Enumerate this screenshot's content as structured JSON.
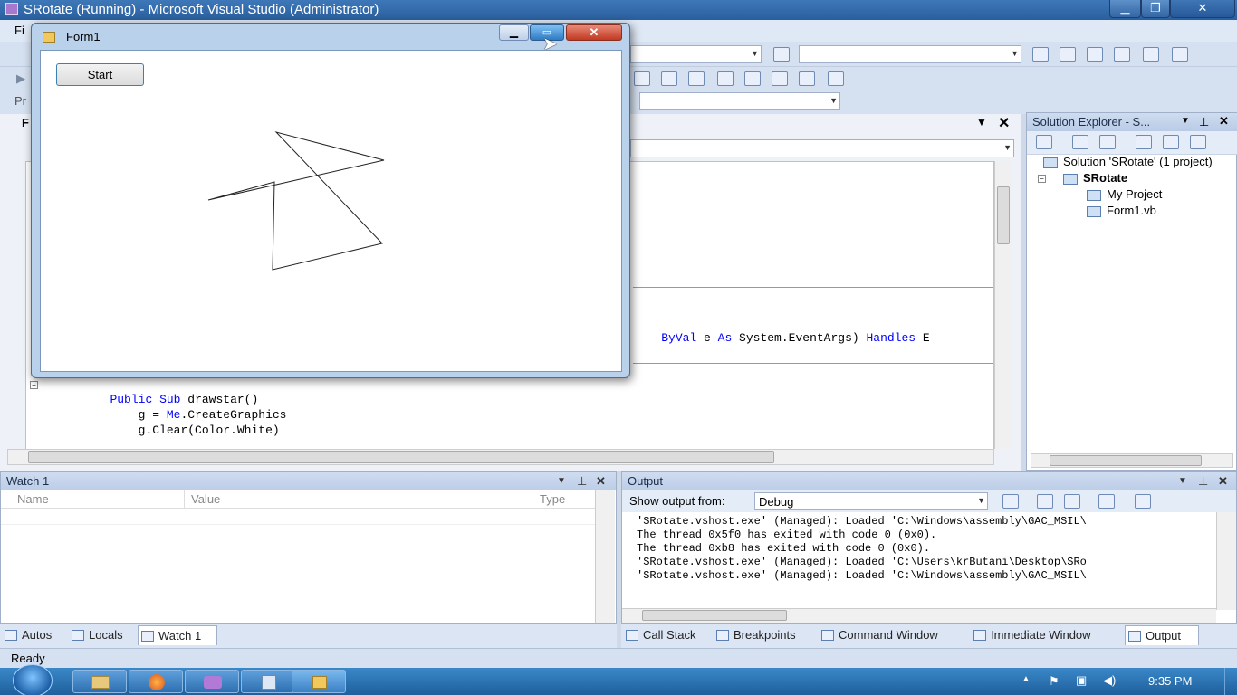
{
  "vs": {
    "title": "SRotate (Running) - Microsoft Visual Studio (Administrator)",
    "menu_first": "Fi",
    "toolbar_fragments": {
      "pr": "Pr"
    },
    "editor_tab": "F"
  },
  "editor": {
    "lines": [
      {
        "indent": "    ",
        "kw1": "Public",
        "mid": " ",
        "kw2": "Sub",
        "rest": " drawstar()"
      },
      {
        "indent": "        ",
        "pre": "g = ",
        "kw": "Me",
        "post": ".CreateGraphics"
      },
      {
        "indent": "        ",
        "pre": "g.Clear(Color.White)"
      }
    ],
    "handler_fragment": {
      "kw1": "ByVal",
      "mid1": " e ",
      "kw2": "As",
      "mid2": " System.EventArgs) ",
      "kw3": "Handles",
      "end": " E"
    }
  },
  "solution_explorer": {
    "title": "Solution Explorer - S...",
    "items": [
      {
        "label": "Solution 'SRotate' (1 project)"
      },
      {
        "label": "SRotate"
      },
      {
        "label": "My Project"
      },
      {
        "label": "Form1.vb"
      }
    ]
  },
  "watch": {
    "title": "Watch 1",
    "columns": [
      "Name",
      "Value",
      "Type"
    ]
  },
  "output": {
    "title": "Output",
    "show_output_from_label": "Show output from:",
    "source": "Debug",
    "lines": [
      "'SRotate.vshost.exe' (Managed): Loaded 'C:\\Windows\\assembly\\GAC_MSIL\\",
      "The thread 0x5f0 has exited with code 0 (0x0).",
      "The thread 0xb8 has exited with code 0 (0x0).",
      "'SRotate.vshost.exe' (Managed): Loaded 'C:\\Users\\krButani\\Desktop\\SRo",
      "'SRotate.vshost.exe' (Managed): Loaded 'C:\\Windows\\assembly\\GAC_MSIL\\"
    ]
  },
  "left_tabs": [
    "Autos",
    "Locals",
    "Watch 1"
  ],
  "right_tabs": [
    "Call Stack",
    "Breakpoints",
    "Command Window",
    "Immediate Window",
    "Output"
  ],
  "status": "Ready",
  "form1": {
    "title": "Form1",
    "button": "Start"
  },
  "taskbar": {
    "clock": "9:35 PM"
  }
}
